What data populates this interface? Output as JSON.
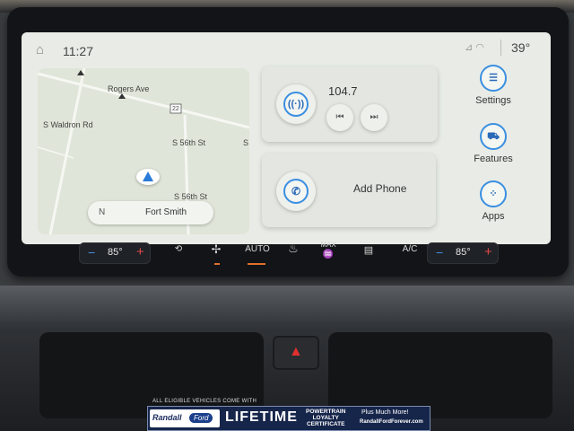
{
  "status_bar": {
    "time": "11:27",
    "temperature": "39°",
    "icons": [
      "home-icon",
      "signal-icon",
      "wifi-icon"
    ]
  },
  "map": {
    "streets": [
      "Rogers Ave",
      "S Waldron Rd",
      "S 56th St",
      "S 56th St",
      "S"
    ],
    "route_marker": "22",
    "compass": "N",
    "city": "Fort Smith"
  },
  "radio": {
    "frequency": "104.7",
    "icons": [
      "radio-signal-icon",
      "previous-track-icon",
      "next-track-icon"
    ]
  },
  "phone": {
    "label": "Add Phone",
    "icon": "phone-icon"
  },
  "side_menu": [
    {
      "label": "Settings",
      "icon": "settings-sliders-icon"
    },
    {
      "label": "Features",
      "icon": "car-features-icon"
    },
    {
      "label": "Apps",
      "icon": "apps-grid-icon"
    }
  ],
  "climate": {
    "left_temp": "85°",
    "right_temp": "85°",
    "auto_label": "AUTO",
    "max_label": "MAX",
    "ac_label": "A/C",
    "accent": "#e0702a"
  },
  "banner": {
    "top_text": "ALL ELIGIBLE VEHICLES COME WITH",
    "dealer": "Randall",
    "brand": "Ford",
    "headline": "LIFETIME",
    "certificate": "POWERTRAIN\nLOYALTY\nCERTIFICATE",
    "tagline": "Plus Much More!",
    "url": "RandallFordForever.com"
  }
}
